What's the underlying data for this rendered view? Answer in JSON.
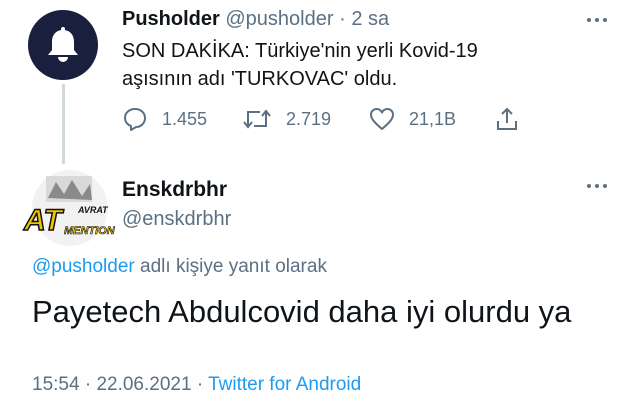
{
  "parent_tweet": {
    "display_name": "Pusholder",
    "handle": "@pusholder",
    "separator": "·",
    "time_ago": "2 sa",
    "text_line1": "SON DAKİKA: Türkiye'nin yerli Kovid-19",
    "text_line2": "aşısının adı 'TURKOVAC' oldu.",
    "replies": "1.455",
    "retweets": "2.719",
    "likes": "21,1B",
    "avatar_icon": "bell-icon"
  },
  "reply_tweet": {
    "display_name": "Enskdrbhr",
    "handle": "@enskdrbhr",
    "avatar_text_top": "AVRAT",
    "avatar_text_main": "AT",
    "avatar_text_bottom": "MENTION",
    "replying_to_handle": "@pusholder",
    "replying_to_suffix": "adlı kişiye yanıt olarak",
    "text": "Payetech Abdulcovid daha iyi olurdu ya",
    "time": "15:54",
    "date": "22.06.2021",
    "separator": "·",
    "source": "Twitter for Android"
  },
  "colors": {
    "link": "#1d9bf0",
    "muted": "#5b7083",
    "avatar_bg": "#1a1f3d",
    "thread_line": "#cfd9de"
  }
}
